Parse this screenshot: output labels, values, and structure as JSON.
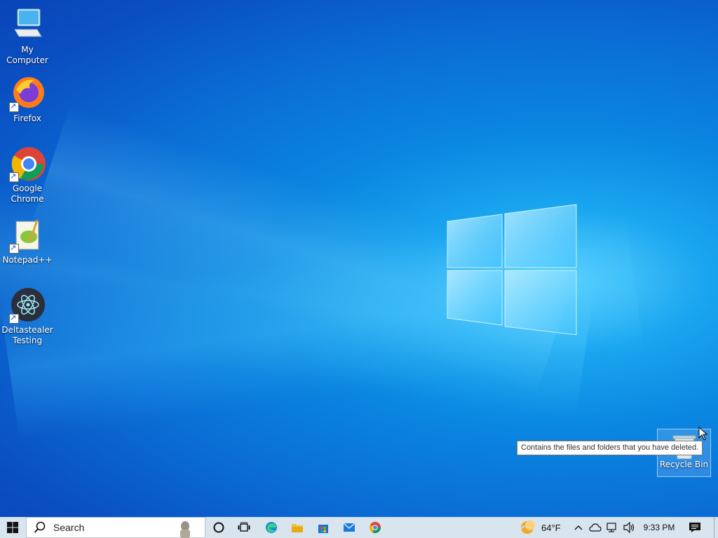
{
  "desktop": {
    "icons": [
      {
        "label": "My Computer"
      },
      {
        "label": "Firefox"
      },
      {
        "label": "Google Chrome"
      },
      {
        "label": "Notepad++"
      },
      {
        "label": "Deltastealer Testing"
      }
    ],
    "recycle_bin": {
      "label": "Recycle Bin"
    },
    "tooltip": "Contains the files and folders that you have deleted."
  },
  "taskbar": {
    "search_placeholder": "Search",
    "pinned": [
      "cortana-icon",
      "task-view-icon",
      "edge-icon",
      "file-explorer-icon",
      "store-icon",
      "mail-icon",
      "chrome-icon"
    ],
    "weather": "64°F",
    "clock": "9:33 PM"
  },
  "colors": {
    "desktop_blue": "#0a86e0",
    "taskbar_bg": "#d8e4ee"
  }
}
